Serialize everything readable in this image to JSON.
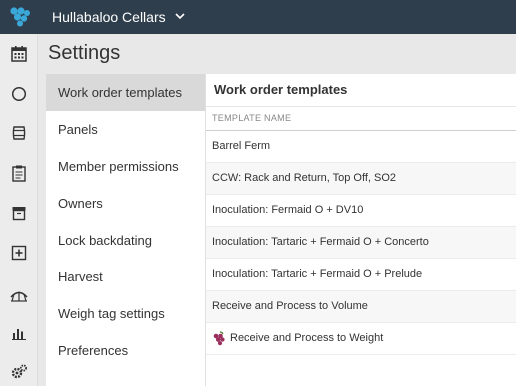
{
  "topbar": {
    "org_name": "Hullabaloo Cellars",
    "logo_icon": "grape-cluster-logo",
    "dropdown_icon": "chevron-down-icon",
    "background": "#2f3e4d"
  },
  "leftnav": {
    "items": [
      {
        "icon": "calendar-icon"
      },
      {
        "icon": "circle-icon"
      },
      {
        "icon": "barrel-icon"
      },
      {
        "icon": "clipboard-icon"
      },
      {
        "icon": "archive-icon"
      },
      {
        "icon": "plus-square-icon"
      },
      {
        "icon": "vineyard-icon"
      },
      {
        "icon": "bar-chart-icon"
      },
      {
        "icon": "gears-icon"
      }
    ]
  },
  "page": {
    "title": "Settings"
  },
  "submenu": {
    "items": [
      {
        "label": "Work order templates",
        "active": true
      },
      {
        "label": "Panels"
      },
      {
        "label": "Member permissions"
      },
      {
        "label": "Owners"
      },
      {
        "label": "Lock backdating"
      },
      {
        "label": "Harvest"
      },
      {
        "label": "Weigh tag settings"
      },
      {
        "label": "Preferences"
      }
    ]
  },
  "content": {
    "title": "Work order templates",
    "column_header": "TEMPLATE NAME",
    "rows": [
      {
        "name": "Barrel Ferm"
      },
      {
        "name": "CCW: Rack and Return, Top Off, SO2"
      },
      {
        "name": "Inoculation: Fermaid O + DV10"
      },
      {
        "name": "Inoculation: Tartaric + Fermaid O + Concerto"
      },
      {
        "name": "Inoculation: Tartaric + Fermaid O + Prelude"
      },
      {
        "name": "Receive and Process to Volume"
      },
      {
        "name": "Receive and Process to Weight",
        "icon": "grapes-icon"
      }
    ]
  },
  "colors": {
    "accent": "#3aa8d8",
    "active_item": "#d9d9d9",
    "grape": "#9b2f5e"
  }
}
